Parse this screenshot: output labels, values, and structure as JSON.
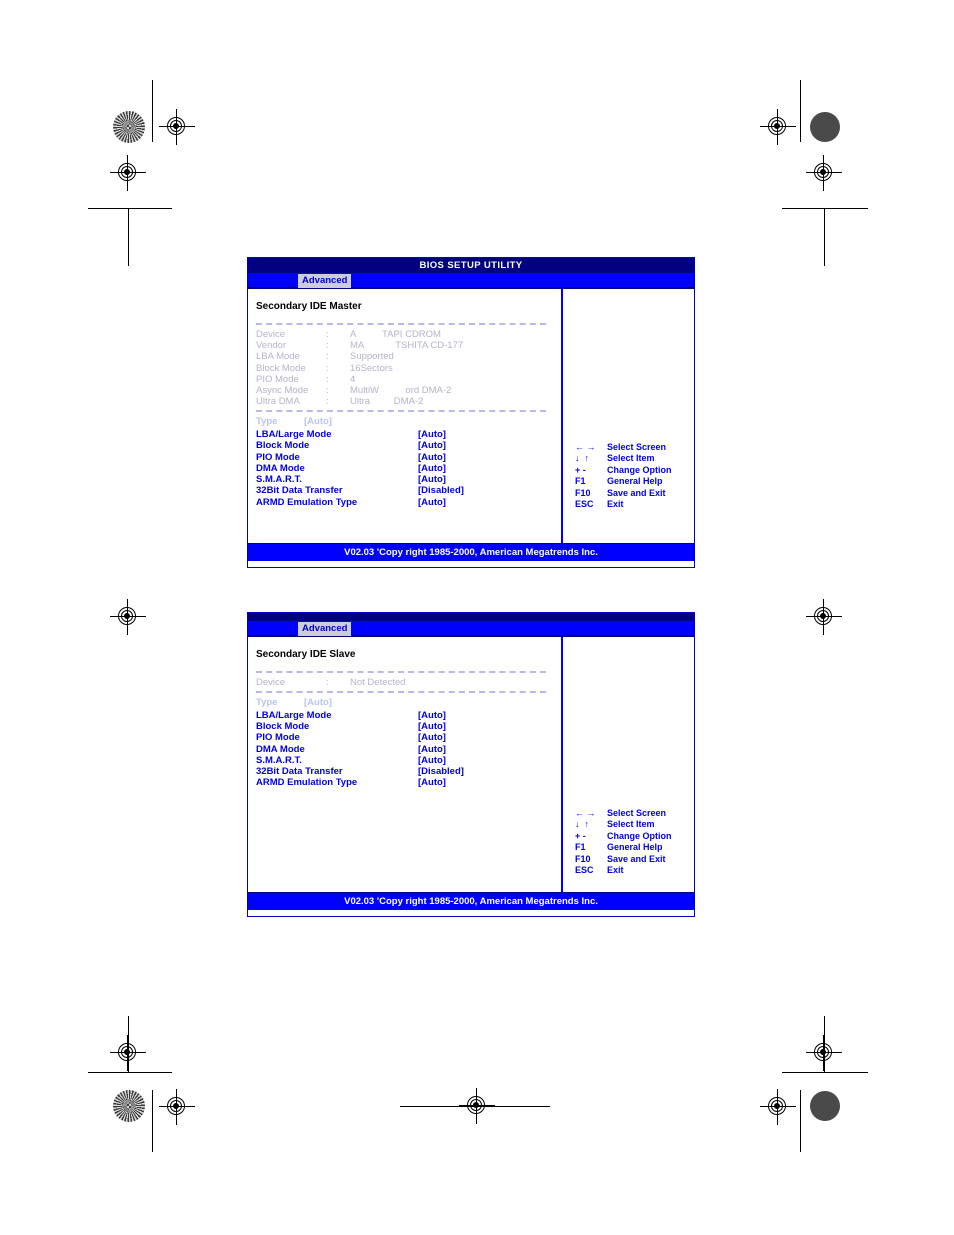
{
  "screens": [
    {
      "title": "BIOS SETUP UTILITY",
      "show_title": true,
      "tab": "Advanced",
      "panel_heading": "Secondary IDE Master",
      "info_rows": [
        {
          "label": "Device",
          "colon": ":",
          "value": "A          TAPI CDROM"
        },
        {
          "label": "Vendor",
          "colon": ":",
          "value": "MA            TSHITA CD-177"
        },
        {
          "label": "LBA Mode",
          "colon": ":",
          "value": "Supported"
        },
        {
          "label": "Block Mode",
          "colon": ":",
          "value": "16Sectors"
        },
        {
          "label": "PIO Mode",
          "colon": ":",
          "value": "4"
        },
        {
          "label": "Async Mode",
          "colon": ":",
          "value": "MultiW          ord DMA-2"
        },
        {
          "label": "Ultra DMA",
          "colon": ":",
          "value": "Ultra         DMA-2"
        }
      ],
      "type_row": {
        "label": "Type",
        "value": "[Auto]"
      },
      "options": [
        {
          "label": "LBA/Large Mode",
          "value": "[Auto]"
        },
        {
          "label": "Block Mode",
          "value": "[Auto]"
        },
        {
          "label": "PIO Mode",
          "value": "[Auto]"
        },
        {
          "label": "DMA Mode",
          "value": "[Auto]"
        },
        {
          "label": "S.M.A.R.T.",
          "value": "[Auto]"
        },
        {
          "label": "32Bit Data Transfer",
          "value": "[Disabled]"
        },
        {
          "label": "ARMD Emulation Type",
          "value": "[Auto]"
        }
      ],
      "legend": [
        {
          "key": "← →",
          "desc": "Select Screen"
        },
        {
          "key": "↓  ↑",
          "desc": "Select Item"
        },
        {
          "key": "+ -",
          "desc": "Change Option"
        },
        {
          "key": "F1",
          "desc": "General Help"
        },
        {
          "key": "F10",
          "desc": "Save and Exit"
        },
        {
          "key": "ESC",
          "desc": "Exit"
        }
      ],
      "footer": "V02.03 'Copy  right 1985-2000, American Megatrends Inc."
    },
    {
      "title": "",
      "show_title": false,
      "tab": "Advanced",
      "panel_heading": "Secondary IDE Slave",
      "info_rows": [
        {
          "label": "Device",
          "colon": ":",
          "value": "Not Detected"
        }
      ],
      "type_row": {
        "label": "Type",
        "value": "[Auto]"
      },
      "options": [
        {
          "label": "LBA/Large Mode",
          "value": "[Auto]"
        },
        {
          "label": "Block Mode",
          "value": "[Auto]"
        },
        {
          "label": "PIO Mode",
          "value": "[Auto]"
        },
        {
          "label": "DMA Mode",
          "value": "[Auto]"
        },
        {
          "label": "S.M.A.R.T.",
          "value": "[Auto]"
        },
        {
          "label": "32Bit Data Transfer",
          "value": "[Disabled]"
        },
        {
          "label": "ARMD Emulation Type",
          "value": "[Auto]"
        }
      ],
      "legend": [
        {
          "key": "← →",
          "desc": "Select Screen"
        },
        {
          "key": "↓  ↑",
          "desc": "Select Item"
        },
        {
          "key": "+ -",
          "desc": "Change Option"
        },
        {
          "key": "F1",
          "desc": "General Help"
        },
        {
          "key": "F10",
          "desc": "Save and Exit"
        },
        {
          "key": "ESC",
          "desc": "Exit"
        }
      ],
      "footer": "V02.03 'Copy  right 1985-2000, American Megatrends Inc."
    }
  ],
  "colors": {
    "title_bar": "#000080",
    "tab_bar": "#0000ff",
    "option_text": "#0000dd",
    "info_text": "#b4b4c8",
    "footer_bar": "#0000ff"
  }
}
